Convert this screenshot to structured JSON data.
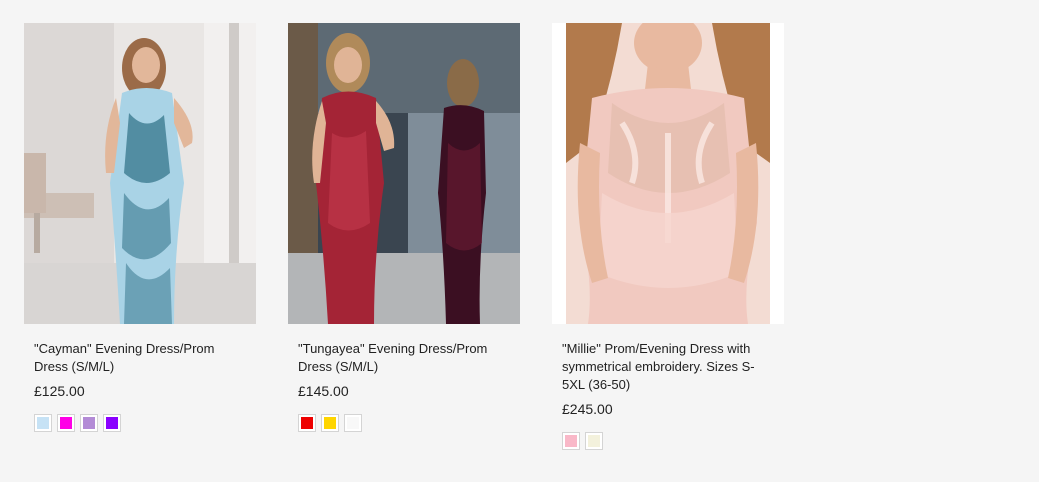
{
  "products": [
    {
      "title": "\"Cayman\" Evening Dress/Prom Dress (S/M/L)",
      "price": "£125.00",
      "image": "blue-sequin-evening-dress-photo",
      "swatches": [
        "#c6e2f5",
        "#ff00e6",
        "#b38bd6",
        "#8a00ff"
      ]
    },
    {
      "title": "\"Tungayea\" Evening Dress/Prom Dress (S/M/L)",
      "price": "£145.00",
      "image": "burgundy-sequin-evening-dress-photo",
      "swatches": [
        "#ee0000",
        "#ffd500",
        "#f8f8f8"
      ]
    },
    {
      "title": "\"Millie\" Prom/Evening Dress with symmetrical embroidery. Sizes S-5XL (36-50)",
      "price": "£245.00",
      "image": "pink-embroidered-prom-dress-photo",
      "swatches": [
        "#f9b8c8",
        "#f3f1dc"
      ]
    }
  ]
}
